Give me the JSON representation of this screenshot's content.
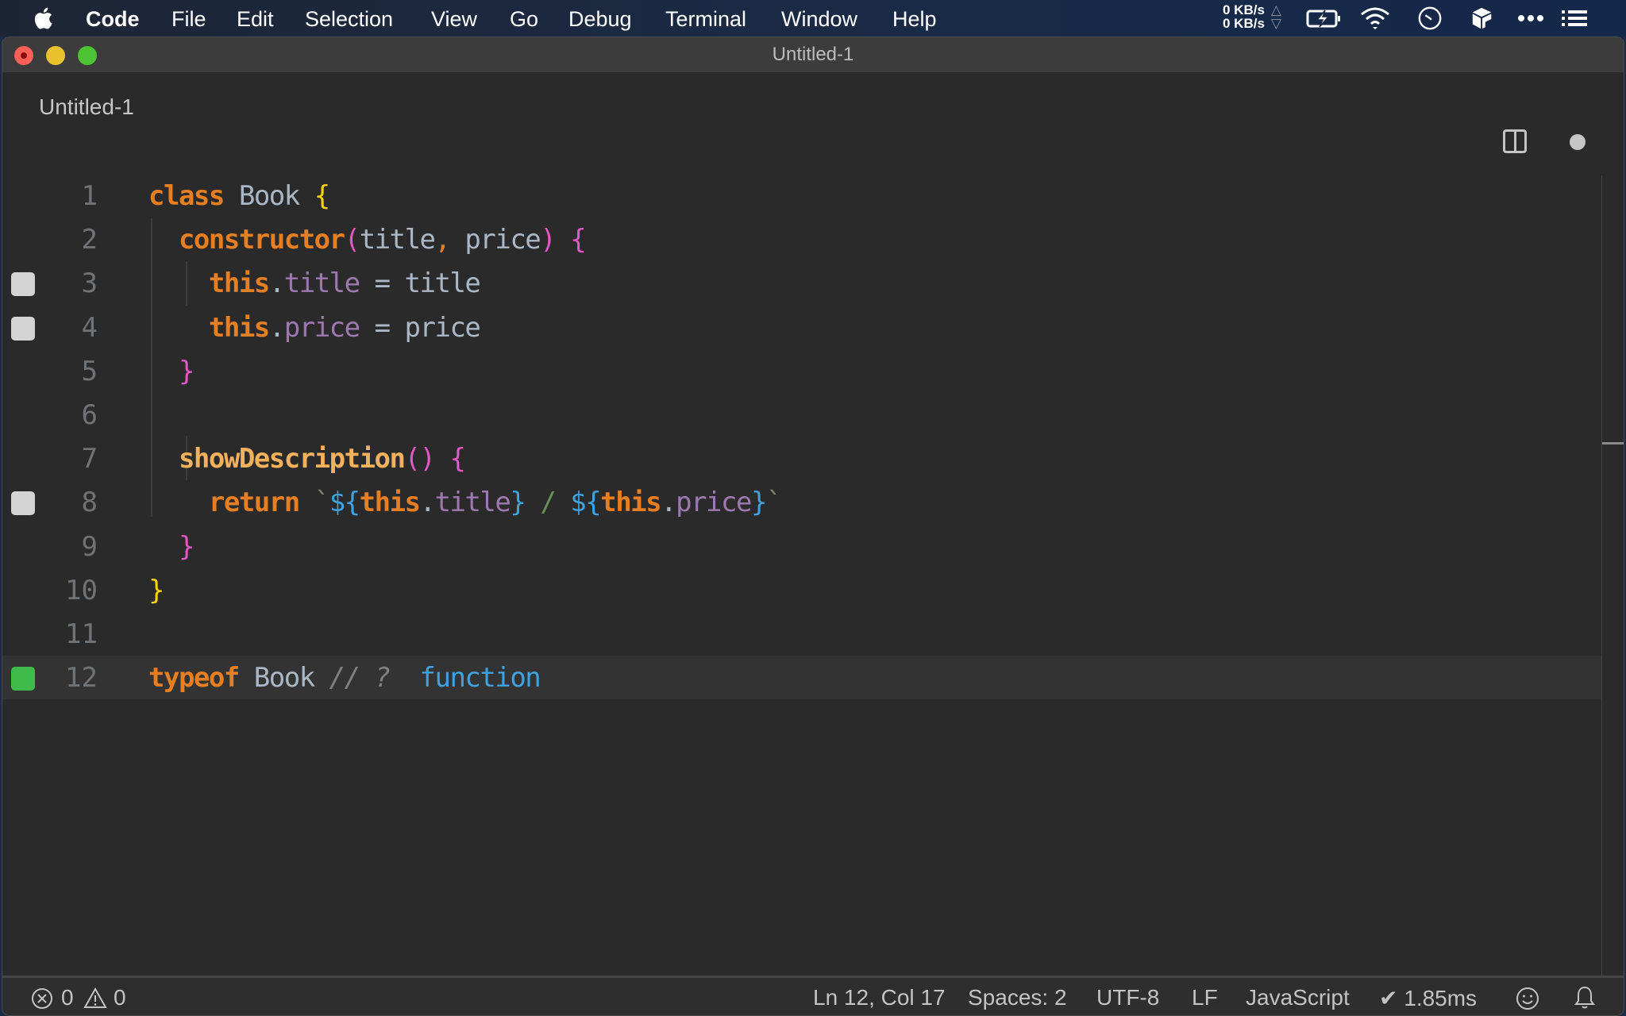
{
  "menubar": {
    "app_name": "Code",
    "items": [
      "File",
      "Edit",
      "Selection",
      "View",
      "Go",
      "Debug",
      "Terminal",
      "Window",
      "Help"
    ],
    "network": {
      "upload": "0 KB/s",
      "download": "0 KB/s",
      "up_arrow": "△",
      "down_arrow": "▽"
    },
    "tray_icons": [
      "battery-charging-icon",
      "wifi-icon",
      "clock-icon",
      "box-icon",
      "more-icon",
      "list-icon"
    ]
  },
  "window": {
    "title": "Untitled-1"
  },
  "tab": {
    "label": "Untitled-1",
    "dirty": true
  },
  "editor": {
    "language": "JavaScript",
    "current_line": 12,
    "lines": [
      {
        "number": "1",
        "marker": "none",
        "tokens": [
          [
            "kw",
            "class"
          ],
          [
            "plain",
            " "
          ],
          [
            "cls",
            "Book"
          ],
          [
            "plain",
            " "
          ],
          [
            "brace-y",
            "{"
          ]
        ]
      },
      {
        "number": "2",
        "marker": "none",
        "tokens": [
          [
            "plain",
            "  "
          ],
          [
            "kw",
            "constructor"
          ],
          [
            "brace-p",
            "("
          ],
          [
            "plain",
            "title"
          ],
          [
            "comma",
            ","
          ],
          [
            "plain",
            " price"
          ],
          [
            "brace-p",
            ")"
          ],
          [
            "plain",
            " "
          ],
          [
            "brace-p",
            "{"
          ]
        ]
      },
      {
        "number": "3",
        "marker": "gray",
        "tokens": [
          [
            "plain",
            "    "
          ],
          [
            "kw",
            "this"
          ],
          [
            "dot",
            "."
          ],
          [
            "prop",
            "title"
          ],
          [
            "plain",
            " = title"
          ]
        ]
      },
      {
        "number": "4",
        "marker": "gray",
        "tokens": [
          [
            "plain",
            "    "
          ],
          [
            "kw",
            "this"
          ],
          [
            "dot",
            "."
          ],
          [
            "prop",
            "price"
          ],
          [
            "plain",
            " = price"
          ]
        ]
      },
      {
        "number": "5",
        "marker": "none",
        "tokens": [
          [
            "plain",
            "  "
          ],
          [
            "brace-p",
            "}"
          ]
        ]
      },
      {
        "number": "6",
        "marker": "none",
        "tokens": []
      },
      {
        "number": "7",
        "marker": "none",
        "tokens": [
          [
            "plain",
            "  "
          ],
          [
            "fn",
            "showDescription"
          ],
          [
            "brace-p",
            "()"
          ],
          [
            "plain",
            " "
          ],
          [
            "brace-p",
            "{"
          ]
        ]
      },
      {
        "number": "8",
        "marker": "gray",
        "tokens": [
          [
            "plain",
            "    "
          ],
          [
            "kw",
            "return"
          ],
          [
            "plain",
            " "
          ],
          [
            "tick",
            "`"
          ],
          [
            "tmpl",
            "${"
          ],
          [
            "kw",
            "this"
          ],
          [
            "dot",
            "."
          ],
          [
            "prop",
            "title"
          ],
          [
            "tmpl",
            "}"
          ],
          [
            "slash",
            " / "
          ],
          [
            "tmpl",
            "${"
          ],
          [
            "kw",
            "this"
          ],
          [
            "dot",
            "."
          ],
          [
            "prop",
            "price"
          ],
          [
            "tmpl",
            "}"
          ],
          [
            "tick",
            "`"
          ]
        ]
      },
      {
        "number": "9",
        "marker": "none",
        "tokens": [
          [
            "plain",
            "  "
          ],
          [
            "brace-p",
            "}"
          ]
        ]
      },
      {
        "number": "10",
        "marker": "none",
        "tokens": [
          [
            "brace-y",
            "}"
          ]
        ]
      },
      {
        "number": "11",
        "marker": "none",
        "tokens": []
      },
      {
        "number": "12",
        "marker": "green",
        "tokens": [
          [
            "kw",
            "typeof"
          ],
          [
            "plain",
            " Book "
          ],
          [
            "cmt",
            "// ?"
          ],
          [
            "plain",
            "  "
          ],
          [
            "res",
            "function"
          ]
        ]
      }
    ]
  },
  "statusbar": {
    "errors": "0",
    "warnings": "0",
    "position": "Ln 12, Col 17",
    "indent": "Spaces: 2",
    "encoding": "UTF-8",
    "eol": "LF",
    "language": "JavaScript",
    "timing": "✔ 1.85ms"
  },
  "colors": {
    "marker_gray": "#d4d4d4",
    "marker_green": "#3fbb4c",
    "keyword": "#e67e22",
    "template": "#3fa2e0",
    "property": "#9e78b0"
  }
}
